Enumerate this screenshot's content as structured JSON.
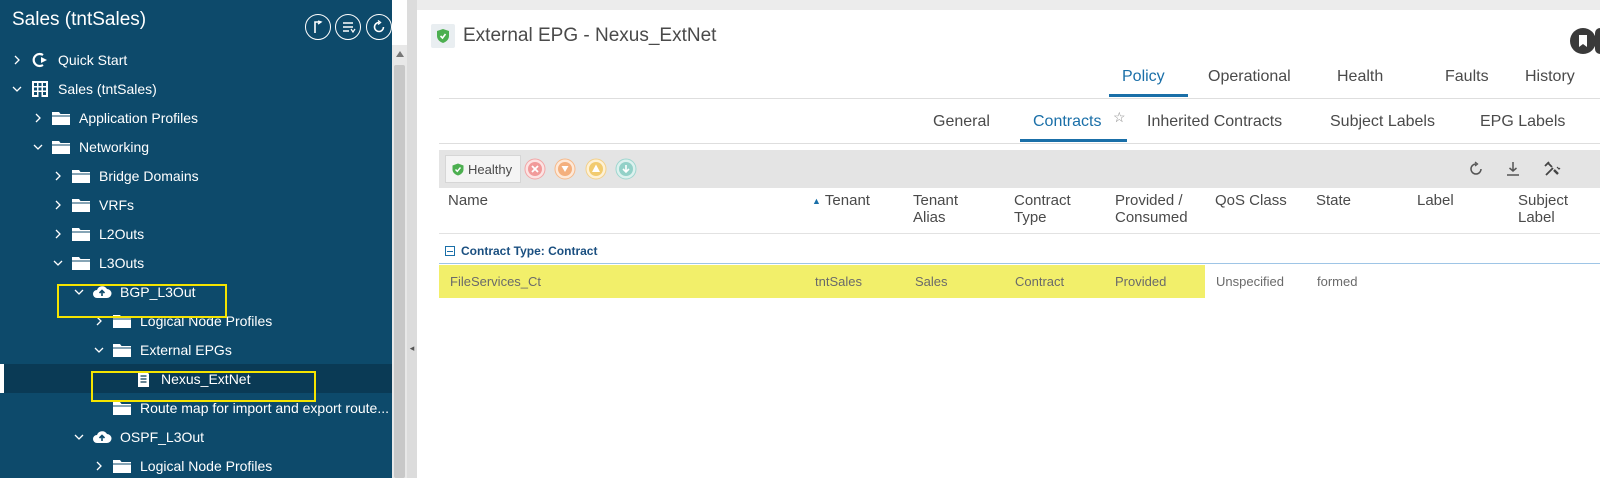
{
  "left_panel": {
    "title": "Sales (tntSales)",
    "header_buttons": [
      "collapse-tree-icon",
      "filter-list-icon",
      "refresh-icon"
    ],
    "tree": [
      {
        "label": "Quick Start",
        "icon": "quickstart-icon",
        "caret": "right",
        "level": 0
      },
      {
        "label": "Sales (tntSales)",
        "icon": "tenant-grid-icon",
        "caret": "down",
        "level": 0
      },
      {
        "label": "Application Profiles",
        "icon": "folder-icon",
        "caret": "right",
        "level": 1
      },
      {
        "label": "Networking",
        "icon": "folder-icon",
        "caret": "down",
        "level": 1
      },
      {
        "label": "Bridge Domains",
        "icon": "folder-icon",
        "caret": "right",
        "level": 2
      },
      {
        "label": "VRFs",
        "icon": "folder-icon",
        "caret": "right",
        "level": 2
      },
      {
        "label": "L2Outs",
        "icon": "folder-icon",
        "caret": "right",
        "level": 2
      },
      {
        "label": "L3Outs",
        "icon": "folder-icon",
        "caret": "down",
        "level": 2
      },
      {
        "label": "BGP_L3Out",
        "icon": "cloud-upload-icon",
        "caret": "down",
        "level": 3
      },
      {
        "label": "Logical Node Profiles",
        "icon": "folder-icon",
        "caret": "right",
        "level": 4
      },
      {
        "label": "External EPGs",
        "icon": "folder-icon",
        "caret": "down",
        "level": 4
      },
      {
        "label": "Nexus_ExtNet",
        "icon": "document-icon",
        "caret": "none",
        "level": 5,
        "selected": true
      },
      {
        "label": "Route map for import and export route...",
        "icon": "folder-icon",
        "caret": "none",
        "level": 4
      },
      {
        "label": "OSPF_L3Out",
        "icon": "cloud-upload-icon",
        "caret": "down",
        "level": 3
      },
      {
        "label": "Logical Node Profiles",
        "icon": "folder-icon",
        "caret": "right",
        "level": 4
      }
    ]
  },
  "main": {
    "title": "External EPG - Nexus_ExtNet",
    "top_tabs": [
      {
        "label": "Policy",
        "active": true
      },
      {
        "label": "Operational",
        "active": false
      },
      {
        "label": "Health",
        "active": false
      },
      {
        "label": "Faults",
        "active": false
      },
      {
        "label": "History",
        "active": false
      }
    ],
    "sub_tabs": [
      {
        "label": "General",
        "active": false
      },
      {
        "label": "Contracts",
        "active": true
      },
      {
        "label": "Inherited Contracts",
        "active": false
      },
      {
        "label": "Subject Labels",
        "active": false
      },
      {
        "label": "EPG Labels",
        "active": false
      }
    ],
    "toolbar": {
      "health_label": "Healthy",
      "fault_filters": [
        "critical-fault-icon",
        "major-fault-icon",
        "minor-fault-icon",
        "warning-fault-icon"
      ],
      "actions": [
        "refresh-icon",
        "download-icon",
        "tools-icon"
      ]
    },
    "table": {
      "columns": [
        {
          "label": "Name"
        },
        {
          "label": "Tenant",
          "sorted": "asc"
        },
        {
          "label": "Tenant\nAlias"
        },
        {
          "label": "Contract\nType"
        },
        {
          "label": "Provided /\nConsumed"
        },
        {
          "label": "QoS Class"
        },
        {
          "label": "State"
        },
        {
          "label": "Label"
        },
        {
          "label": "Subject\nLabel"
        }
      ],
      "group_label": "Contract Type: Contract",
      "rows": [
        {
          "name": "FileServices_Ct",
          "tenant": "tntSales",
          "tenant_alias": "Sales",
          "contract_type": "Contract",
          "provided_consumed": "Provided",
          "qos_class": "Unspecified",
          "state": "formed",
          "label": "",
          "subject_label": ""
        }
      ]
    }
  },
  "colors": {
    "nav_bg": "#0d4a6b",
    "accent": "#1a6fa8",
    "highlight_box": "#f5e400",
    "row_highlight": "#f2ef6a",
    "healthy_green": "#4caf50"
  }
}
